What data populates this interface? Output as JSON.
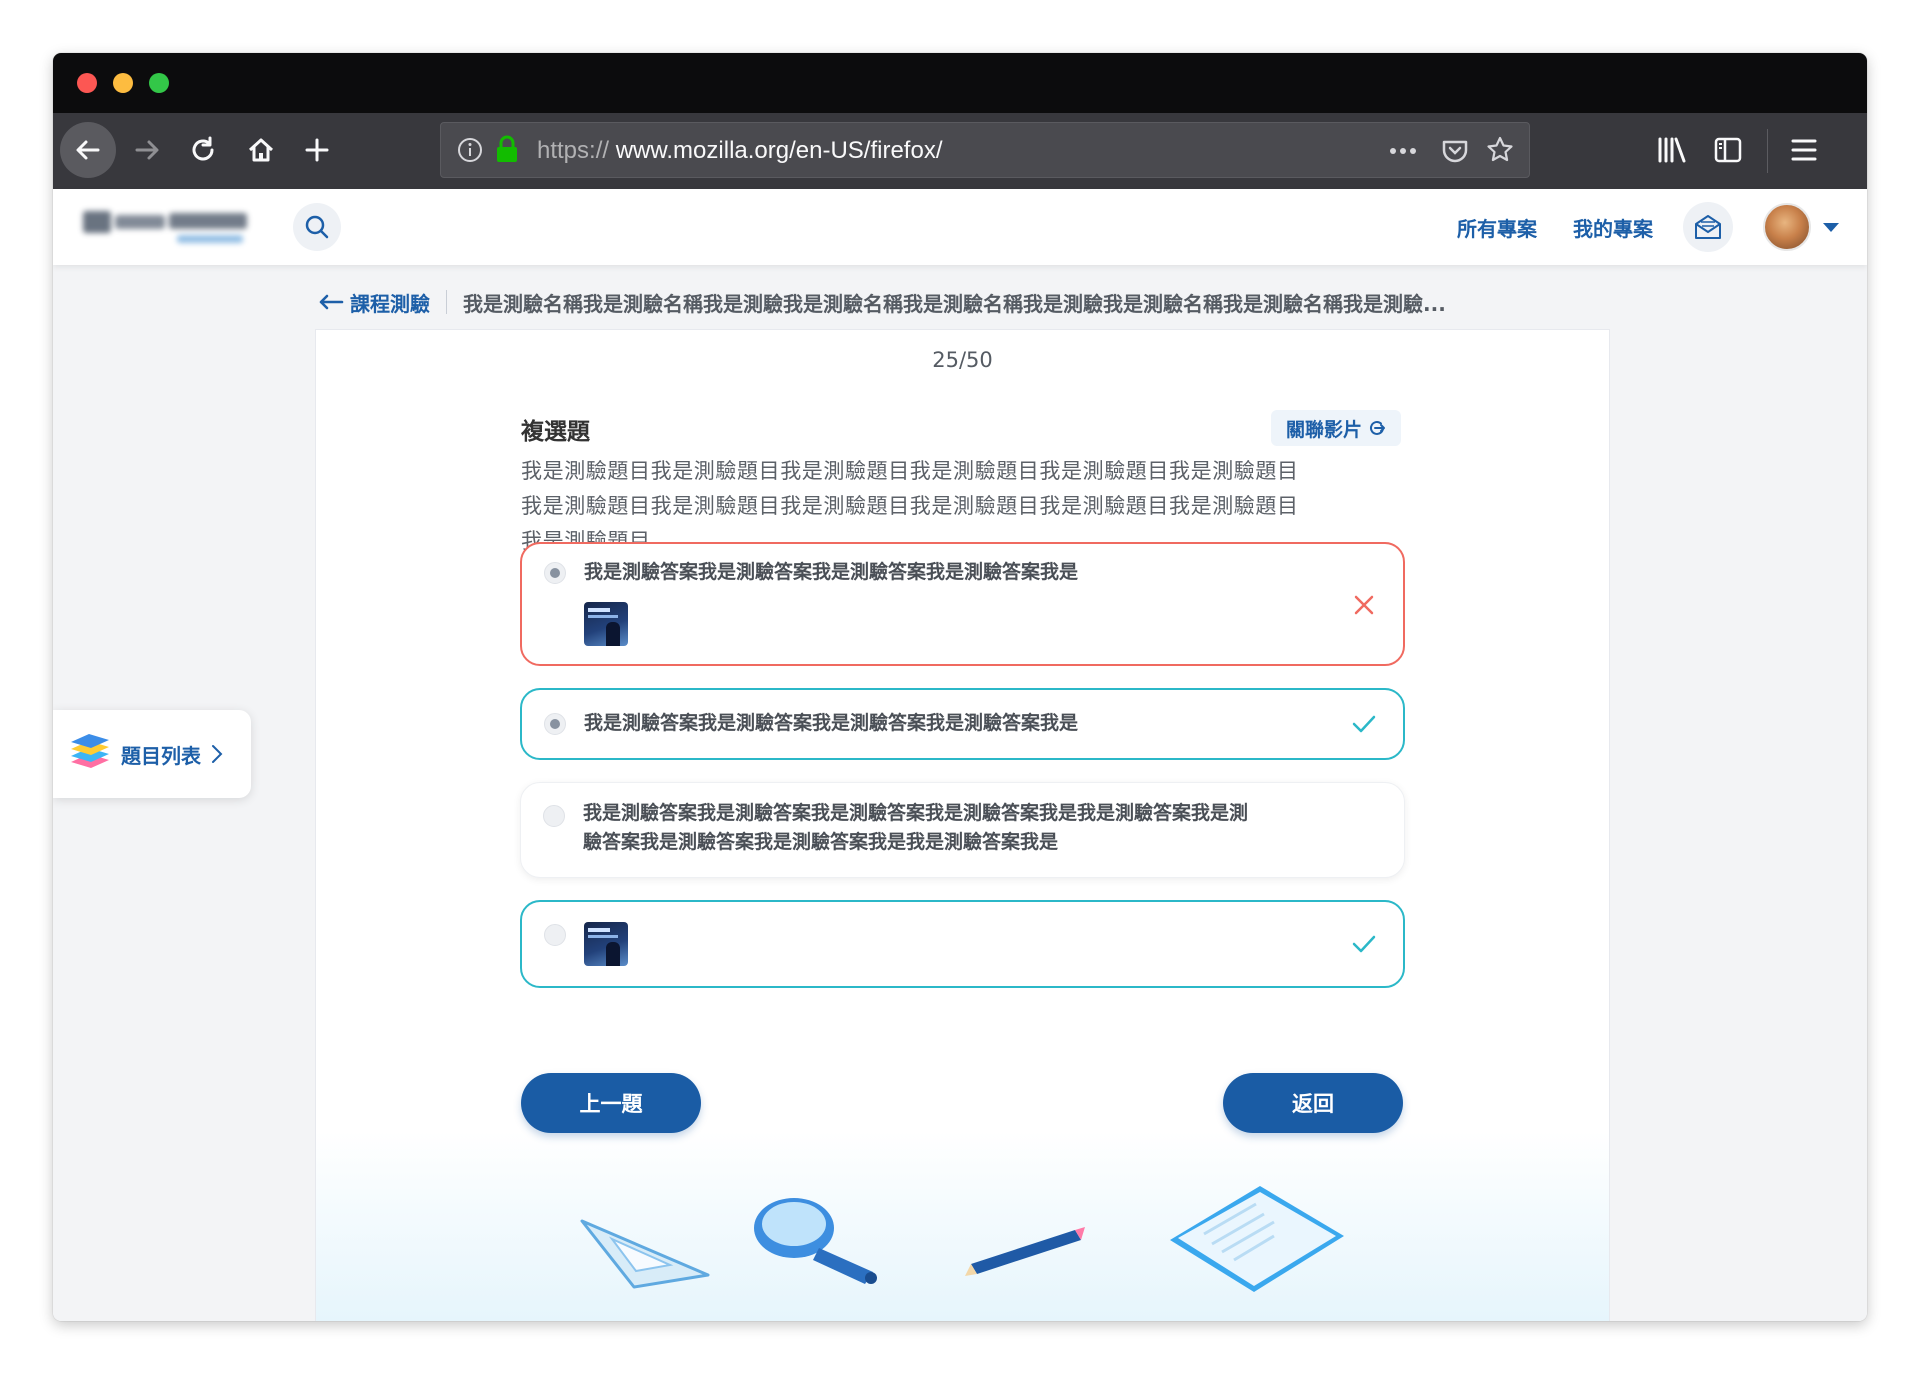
{
  "browser": {
    "url_scheme": "https://",
    "url_rest": "www.mozilla.org/en-US/firefox/"
  },
  "header": {
    "nav_all_projects": "所有專案",
    "nav_my_projects": "我的專案"
  },
  "breadcrumb": {
    "back_label": "課程測驗",
    "title": "我是測驗名稱我是測驗名稱我是測驗我是測驗名稱我是測驗名稱我是測驗我是測驗名稱我是測驗名稱我是測驗..."
  },
  "sidebar": {
    "quiz_list_label": "題目列表"
  },
  "question": {
    "counter": "25/50",
    "type": "複選題",
    "related_video_label": "關聯影片",
    "text_lines": [
      "我是測驗題目我是測驗題目我是測驗題目我是測驗題目我是測驗題目我是測驗題目",
      "我是測驗題目我是測驗題目我是測驗題目我是測驗題目我是測驗題目我是測驗題目",
      "我是測驗題目"
    ]
  },
  "options": [
    {
      "text": "我是測驗答案我是測驗答案我是測驗答案我是測驗答案我是",
      "selected": true,
      "status": "wrong",
      "has_image": true
    },
    {
      "text": "我是測驗答案我是測驗答案我是測驗答案我是測驗答案我是",
      "selected": true,
      "status": "correct",
      "has_image": false
    },
    {
      "text_lines": [
        "我是測驗答案我是測驗答案我是測驗答案我是測驗答案我是我是測驗答案我是測",
        "驗答案我是測驗答案我是測驗答案我是我是測驗答案我是"
      ],
      "selected": false,
      "status": "none",
      "has_image": false
    },
    {
      "text": "",
      "selected": false,
      "status": "correct",
      "has_image": true
    }
  ],
  "actions": {
    "prev_label": "上一題",
    "back_label": "返回"
  },
  "colors": {
    "brand_blue": "#1a5ca5",
    "wrong": "#f06a60",
    "correct": "#2bb8c8"
  }
}
